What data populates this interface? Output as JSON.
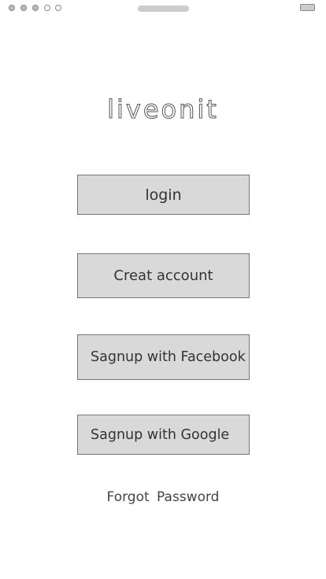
{
  "status_bar": {
    "signal_dots": [
      "filled",
      "filled",
      "filled",
      "empty",
      "empty"
    ],
    "battery_icon": "battery-icon"
  },
  "app": {
    "logo_text": "liveonit"
  },
  "buttons": {
    "login": "login",
    "create_account": "Creat account",
    "facebook": "Sagnup with Facebook",
    "google": "Sagnup with Google"
  },
  "links": {
    "forgot_password": "Forgot  Password"
  },
  "colors": {
    "button_fill": "#d9d9d9",
    "button_border": "#777777",
    "text": "#333333"
  }
}
